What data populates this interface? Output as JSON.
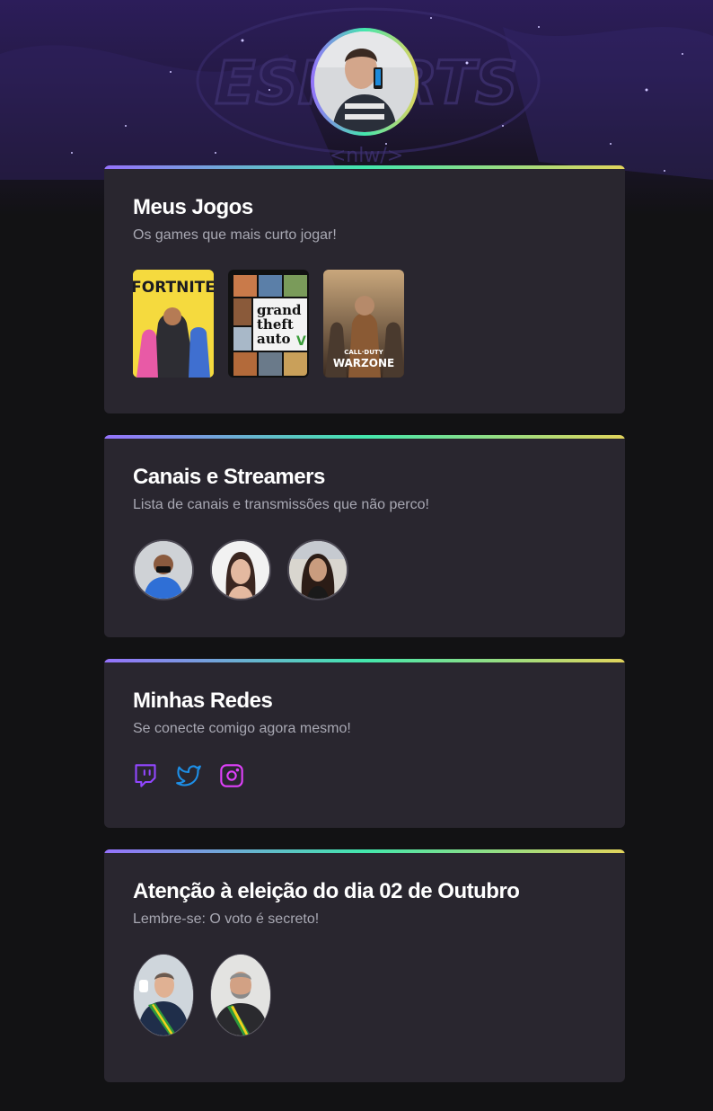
{
  "profile": {
    "avatar_icon": "profile-photo"
  },
  "cards": {
    "games": {
      "title": "Meus Jogos",
      "subtitle": "Os games que mais curto jogar!",
      "items": [
        {
          "name": "FORTNITE",
          "bg": "#f7d93a"
        },
        {
          "name_lines": [
            "grand",
            "theft",
            "auto"
          ],
          "badge": "V",
          "bg": "#111111"
        },
        {
          "name_top": "CALL·DUTY",
          "name": "WARZONE",
          "bg": "#5a3b2a"
        }
      ]
    },
    "streamers": {
      "title": "Canais e Streamers",
      "subtitle": "Lista de canais e transmissões que não perco!",
      "items": [
        "streamer-1",
        "streamer-2",
        "streamer-3"
      ]
    },
    "socials": {
      "title": "Minhas Redes",
      "subtitle": "Se conecte comigo agora mesmo!",
      "items": [
        {
          "icon": "twitch-icon",
          "color": "#9146ff"
        },
        {
          "icon": "twitter-icon",
          "color": "#1d9bf0"
        },
        {
          "icon": "instagram-icon",
          "color": "#e040fb"
        }
      ]
    },
    "election": {
      "title": "Atenção à eleição do dia 02 de Outubro",
      "subtitle": "Lembre-se: O voto é secreto!",
      "items": [
        "candidate-1",
        "candidate-2"
      ]
    }
  },
  "colors": {
    "accent_gradient": [
      "#9572fc",
      "#43e7ad",
      "#e2d45c"
    ],
    "card_bg": "#29262f",
    "page_bg": "#121214"
  }
}
